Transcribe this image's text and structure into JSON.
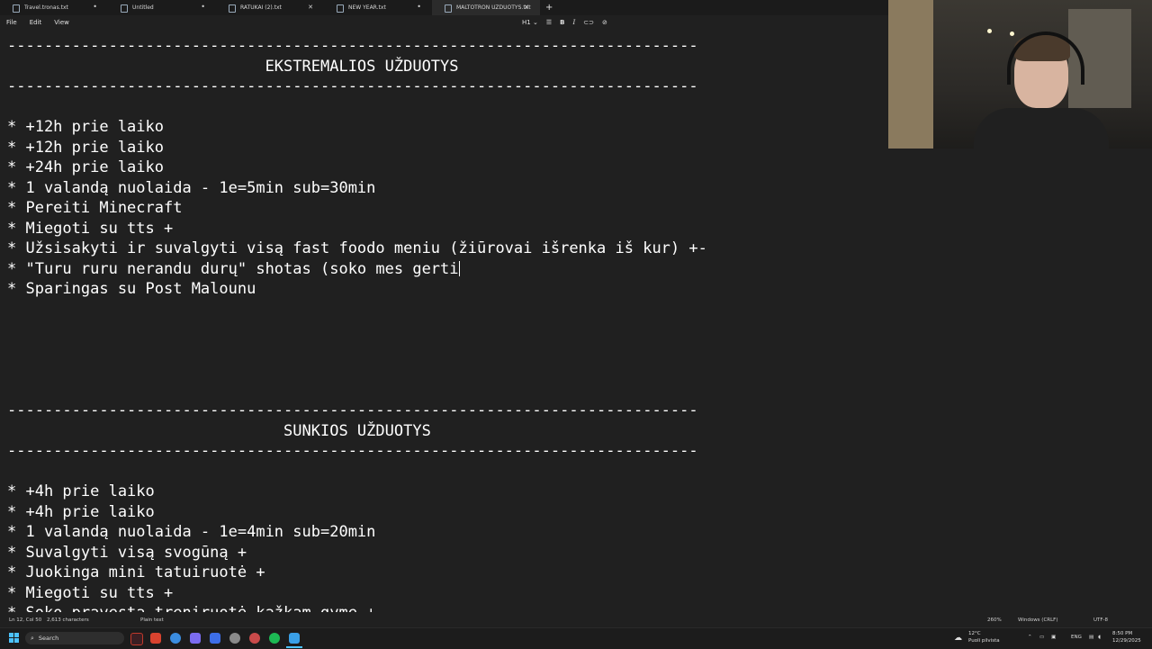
{
  "tabs": [
    {
      "label": "Travel.tronas.txt",
      "modified": true
    },
    {
      "label": "Untitled",
      "modified": true
    },
    {
      "label": "RATUKAI (2).txt",
      "modified": false
    },
    {
      "label": "NEW YEAR.txt",
      "modified": true
    },
    {
      "label": "MALTOTRON UZDUOTYS.txt",
      "modified": false,
      "active": true
    }
  ],
  "menu": {
    "file": "File",
    "edit": "Edit",
    "view": "View"
  },
  "toolbar": {
    "heading": "H1",
    "bold": "B",
    "italic": "I"
  },
  "editor": {
    "lines": [
      "---------------------------------------------------------------------------",
      "                            EKSTREMALIOS UŽDUOTYS",
      "---------------------------------------------------------------------------",
      "",
      "* +12h prie laiko",
      "* +12h prie laiko",
      "* +24h prie laiko",
      "* 1 valandą nuolaida - 1e=5min sub=30min",
      "* Pereiti Minecraft",
      "* Miegoti su tts +",
      "* Užsisakyti ir suvalgyti visą fast foodo meniu (žiūrovai išrenka iš kur) +-",
      "* \"Turu ruru nerandu durų\" shotas (soko mes gerti",
      "* Sparingas su Post Malounu",
      "",
      "",
      "",
      "",
      "",
      "---------------------------------------------------------------------------",
      "                              SUNKIOS UŽDUOTYS",
      "---------------------------------------------------------------------------",
      "",
      "* +4h prie laiko",
      "* +4h prie laiko",
      "* 1 valandą nuolaida - 1e=4min sub=20min",
      "* Suvalgyti visą svogūną +",
      "* Juokinga mini tatuiruotė +",
      "* Miegoti su tts +",
      "* Soko pravesta treniruotė kažkam gyme +"
    ],
    "caret_line": 11
  },
  "statusbar": {
    "position": "Ln 12, Col 50",
    "characters": "2,613 characters",
    "format": "Plain text",
    "zoom": "260%",
    "line_ending": "Windows (CRLF)",
    "encoding": "UTF-8"
  },
  "taskbar": {
    "search_placeholder": "Search",
    "weather_temp": "12°C",
    "weather_desc": "Puoli pilvista",
    "language": "ENG",
    "time": "8:50 PM",
    "date": "12/29/2025"
  },
  "colors": {
    "editor_bg": "#202020",
    "text": "#ffffff",
    "accent": "#4cc2ff"
  }
}
